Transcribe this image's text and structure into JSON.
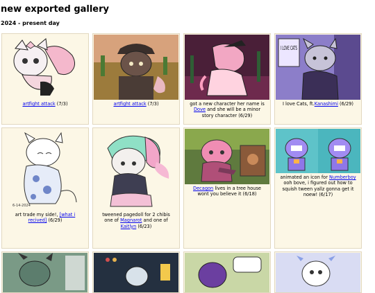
{
  "page": {
    "title": "new exported gallery",
    "subtitle": "2024 - present day"
  },
  "items": [
    {
      "caption_pre": "",
      "link": "artfight attack",
      "caption_post": " (7/3)"
    },
    {
      "caption_pre": "",
      "link": "artfight attack",
      "caption_post": " (7/3)"
    },
    {
      "caption_pre": "got a new character her name is ",
      "link": "Dove",
      "caption_post": " and she will be a minor story character (6/29)"
    },
    {
      "caption_pre": "I love Cats, ft.",
      "link": "Kanashimi",
      "caption_post": " (6/29)"
    },
    {
      "caption_pre": "art trade my side!, ",
      "link": "[what i recived]",
      "caption_post": " (6/29)"
    },
    {
      "caption_pre": "tweened pagedoll for 2 chibis one of ",
      "link": "Magnarot",
      "caption_mid": " and one of ",
      "link2": "Kaitlyn",
      "caption_post": " (6/23)"
    },
    {
      "caption_pre": "",
      "link": "Decagon",
      "caption_post": " lives in a tree house wont you believe it (6/18)"
    },
    {
      "caption_pre": "animated an icon for ",
      "link": "Numberboy",
      "caption_post": " ooh bove, i figured out how to squish tween yallz gonna get it noew! (6/17)"
    }
  ],
  "art_text": {
    "item4_sign": "I LOVE CATS",
    "item5_date": "6-14-2024"
  },
  "colors": {
    "cell_bg": "#fcf7e6",
    "link": "#0000ee"
  }
}
